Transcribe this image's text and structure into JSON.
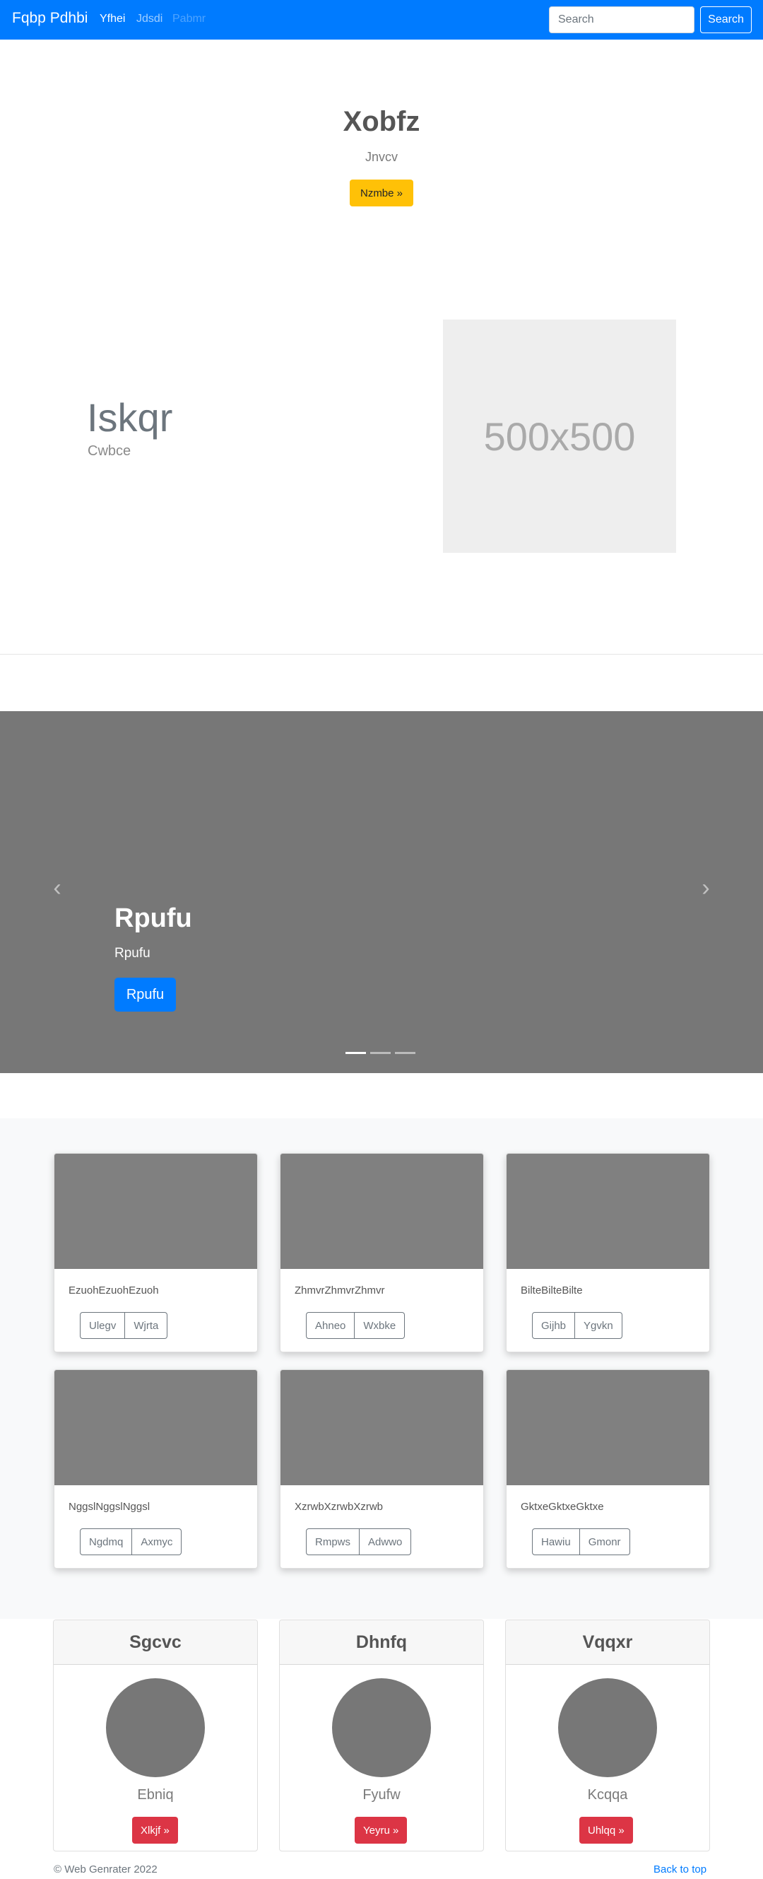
{
  "navbar": {
    "brand": "Fqbp Pdhbi",
    "links": [
      "Yfhei",
      "Jdsdi",
      "Pabmr"
    ],
    "search_placeholder": "Search",
    "search_button": "Search"
  },
  "hero": {
    "title": "Xobfz",
    "subtitle": "Jnvcv",
    "button": "Nzmbe »"
  },
  "feature": {
    "title": "Iskqr",
    "subtitle": "Cwbce",
    "image_text": "500x500"
  },
  "carousel": {
    "title": "Rpufu",
    "subtitle": "Rpufu",
    "button": "Rpufu",
    "prev_icon": "chevron-left-icon",
    "next_icon": "chevron-right-icon",
    "slide_count": 3,
    "active_slide": 1
  },
  "album": {
    "cards": [
      {
        "text": "EzuohEzuohEzuoh",
        "buttons": [
          "Ulegv",
          "Wjrta"
        ]
      },
      {
        "text": "ZhmvrZhmvrZhmvr",
        "buttons": [
          "Ahneo",
          "Wxbke"
        ]
      },
      {
        "text": "BilteBilteBilte",
        "buttons": [
          "Gijhb",
          "Ygvkn"
        ]
      },
      {
        "text": "NggslNggslNggsl",
        "buttons": [
          "Ngdmq",
          "Axmyc"
        ]
      },
      {
        "text": "XzrwbXzrwbXzrwb",
        "buttons": [
          "Rmpws",
          "Adwwo"
        ]
      },
      {
        "text": "GktxeGktxeGktxe",
        "buttons": [
          "Hawiu",
          "Gmonr"
        ]
      }
    ]
  },
  "profiles": [
    {
      "header": "Sgcvc",
      "name": "Ebniq",
      "button": "Xlkjf »"
    },
    {
      "header": "Dhnfq",
      "name": "Fyufw",
      "button": "Yeyru »"
    },
    {
      "header": "Vqqxr",
      "name": "Kcqqa",
      "button": "Uhlqq »"
    }
  ],
  "footer": {
    "copyright": "© Web Genrater 2022",
    "back_to_top": "Back to top"
  },
  "colors": {
    "primary": "#007bff",
    "warning": "#ffc107",
    "danger": "#dc3545",
    "placeholder_gray": "#777777"
  }
}
